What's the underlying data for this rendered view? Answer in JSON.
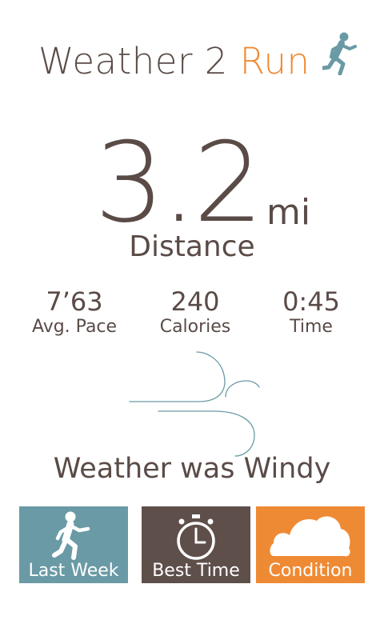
{
  "header": {
    "title_main": "Weather 2",
    "title_accent": "Run"
  },
  "distance": {
    "value": "3.2",
    "unit": "mi",
    "label": "Distance"
  },
  "stats": [
    {
      "value": "7’63",
      "label": "Avg. Pace"
    },
    {
      "value": "240",
      "label": "Calories"
    },
    {
      "value": "0:45",
      "label": "Time"
    }
  ],
  "weather": {
    "text": "Weather was Windy",
    "icon": "wind-icon"
  },
  "tiles": [
    {
      "label": "Last Week",
      "icon": "runner-icon",
      "color": "#6a9aa5"
    },
    {
      "label": "Best Time",
      "icon": "stopwatch-icon",
      "color": "#5f4f4b"
    },
    {
      "label": "Condition",
      "icon": "cloud-icon",
      "color": "#ef8a34"
    }
  ],
  "colors": {
    "text": "#5a4b47",
    "accent": "#ef8a34",
    "teal": "#6a9aa5"
  }
}
